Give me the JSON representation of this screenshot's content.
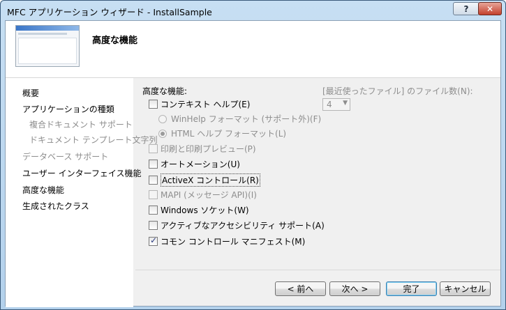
{
  "window": {
    "title": "MFC アプリケーション ウィザード - InstallSample",
    "help_glyph": "?",
    "close_glyph": "✕"
  },
  "header": {
    "title": "高度な機能"
  },
  "nav": {
    "items": [
      {
        "label": "概要"
      },
      {
        "label": "アプリケーションの種類"
      },
      {
        "label": "複合ドキュメント サポート"
      },
      {
        "label": "ドキュメント テンプレート文字列"
      },
      {
        "label": "データベース サポート"
      },
      {
        "label": "ユーザー インターフェイス機能"
      },
      {
        "label": "高度な機能"
      },
      {
        "label": "生成されたクラス"
      }
    ]
  },
  "panel": {
    "group_label": "高度な機能:",
    "options": {
      "context_help": "コンテキスト ヘルプ(E)",
      "winhelp": "WinHelp フォーマット (サポート外)(F)",
      "htmlhelp": "HTML ヘルプ フォーマット(L)",
      "print_preview": "印刷と印刷プレビュー(P)",
      "automation": "オートメーション(U)",
      "activex": "ActiveX コントロール(R)",
      "mapi": "MAPI (メッセージ API)(I)",
      "sockets": "Windows ソケット(W)",
      "accessibility": "アクティブなアクセシビリティ サポート(A)",
      "common_controls": "コモン コントロール マニフェスト(M)"
    },
    "check_glyph": "✓",
    "mru": {
      "label": "[最近使ったファイル] のファイル数(N):",
      "value": "4",
      "arrow": "▼"
    }
  },
  "buttons": {
    "back": "< 前へ",
    "next": "次へ >",
    "finish": "完了",
    "cancel": "キャンセル"
  }
}
